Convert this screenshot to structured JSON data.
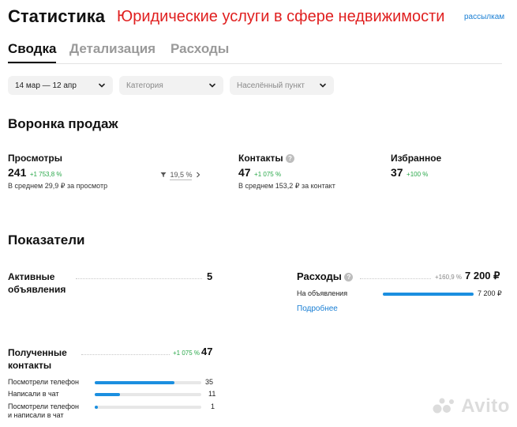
{
  "header": {
    "title": "Статистика",
    "overlay_title": "Юридические услуги в сфере недвижимости",
    "link": "рассылкам"
  },
  "tabs": [
    {
      "label": "Сводка",
      "active": true
    },
    {
      "label": "Детализация",
      "active": false
    },
    {
      "label": "Расходы",
      "active": false
    }
  ],
  "filters": {
    "period": "14 мар — 12 апр",
    "category_placeholder": "Категория",
    "city_placeholder": "Населённый пункт"
  },
  "funnel": {
    "title": "Воронка продаж",
    "views": {
      "label": "Просмотры",
      "value": "241",
      "delta": "+1 753,8 %",
      "sub": "В среднем 29,9 ₽ за просмотр",
      "conversion": "19,5 %"
    },
    "contacts": {
      "label": "Контакты",
      "value": "47",
      "delta": "+1 075 %",
      "sub": "В среднем 153,2 ₽ за контакт"
    },
    "favorites": {
      "label": "Избранное",
      "value": "37",
      "delta": "+100 %"
    }
  },
  "indicators": {
    "title": "Показатели",
    "active_ads": {
      "label_line1": "Активные",
      "label_line2": "объявления",
      "value": "5"
    },
    "expenses": {
      "label": "Расходы",
      "delta": "+160,9 %",
      "value": "7 200 ₽",
      "rows": [
        {
          "label": "На объявления",
          "value": "7 200 ₽",
          "fraction": 1.0
        }
      ],
      "more_link": "Подробнее"
    },
    "contacts_received": {
      "label_line1": "Полученные",
      "label_line2": "контакты",
      "delta": "+1 075 %",
      "value": "47",
      "rows": [
        {
          "label": "Посмотрели телефон",
          "value": "35",
          "fraction": 0.745
        },
        {
          "label": "Написали в чат",
          "value": "11",
          "fraction": 0.234
        },
        {
          "label_line1": "Посмотрели телефон",
          "label_line2": "и написали в чат",
          "value": "1",
          "fraction": 0.021
        }
      ]
    }
  },
  "watermark": "Avito",
  "colors": {
    "accent": "#1b8fe0",
    "positive": "#2aa84a",
    "overlay_red": "#e01f1f"
  }
}
